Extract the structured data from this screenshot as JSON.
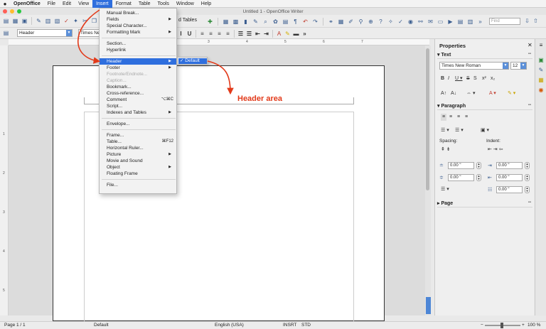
{
  "menubar": {
    "app": "OpenOffice",
    "items": [
      "File",
      "Edit",
      "View",
      "Insert",
      "Format",
      "Table",
      "Tools",
      "Window",
      "Help"
    ],
    "active": "Insert"
  },
  "window": {
    "title": "Untitled 1 - OpenOffice Writer"
  },
  "toolbar": {
    "tables_label": "d Tables",
    "style_value": "Header",
    "font_value": "Times Ne",
    "find_placeholder": "Find"
  },
  "ruler": {
    "ticks": [
      "1",
      "2",
      "3",
      "4",
      "5",
      "6",
      "7"
    ]
  },
  "vruler": {
    "ticks": [
      "1",
      "2",
      "3",
      "4",
      "5"
    ]
  },
  "document": {
    "annotation": "Header area"
  },
  "insert_menu": {
    "items": [
      {
        "label": "Manual Break...",
        "state": "normal"
      },
      {
        "label": "Fields",
        "state": "normal",
        "submenu": true
      },
      {
        "label": "Special Character...",
        "state": "normal"
      },
      {
        "label": "Formatting Mark",
        "state": "normal",
        "submenu": true
      },
      {
        "label": "Section...",
        "state": "normal"
      },
      {
        "label": "Hyperlink",
        "state": "normal"
      },
      {
        "label": "Header",
        "state": "highlighted",
        "submenu": true
      },
      {
        "label": "Footer",
        "state": "normal",
        "submenu": true
      },
      {
        "label": "Footnote/Endnote...",
        "state": "disabled"
      },
      {
        "label": "Caption...",
        "state": "disabled"
      },
      {
        "label": "Bookmark...",
        "state": "normal"
      },
      {
        "label": "Cross-reference...",
        "state": "normal"
      },
      {
        "label": "Comment",
        "state": "normal",
        "shortcut": "⌥⌘C"
      },
      {
        "label": "Script...",
        "state": "normal"
      },
      {
        "label": "Indexes and Tables",
        "state": "normal",
        "submenu": true
      },
      {
        "label": "Envelope...",
        "state": "normal"
      },
      {
        "label": "Frame...",
        "state": "normal"
      },
      {
        "label": "Table...",
        "state": "normal",
        "shortcut": "⌘F12"
      },
      {
        "label": "Horizontal Ruler...",
        "state": "normal"
      },
      {
        "label": "Picture",
        "state": "normal",
        "submenu": true
      },
      {
        "label": "Movie and Sound",
        "state": "normal"
      },
      {
        "label": "Object",
        "state": "normal",
        "submenu": true
      },
      {
        "label": "Floating Frame",
        "state": "normal"
      },
      {
        "label": "File...",
        "state": "normal"
      }
    ],
    "header_submenu": {
      "item": "✓ Default"
    }
  },
  "sidebar": {
    "title": "Properties",
    "text_section": "Text",
    "font_name": "Times New Roman",
    "font_size": "12",
    "paragraph_section": "Paragraph",
    "spacing_label": "Spacing:",
    "indent_label": "Indent:",
    "spin_above": "0.00 \"",
    "spin_below": "0.00 \"",
    "spin_before": "0.00 \"",
    "spin_after": "0.00 \"",
    "spin_first": "0.00 \"",
    "page_section": "Page"
  },
  "status": {
    "page": "Page 1 / 1",
    "style": "Default",
    "language": "English (USA)",
    "mode": "INSRT",
    "selection": "STD",
    "zoom": "100 %"
  },
  "colors": {
    "accent": "#2f6fde",
    "annotation": "#e23a1a"
  }
}
